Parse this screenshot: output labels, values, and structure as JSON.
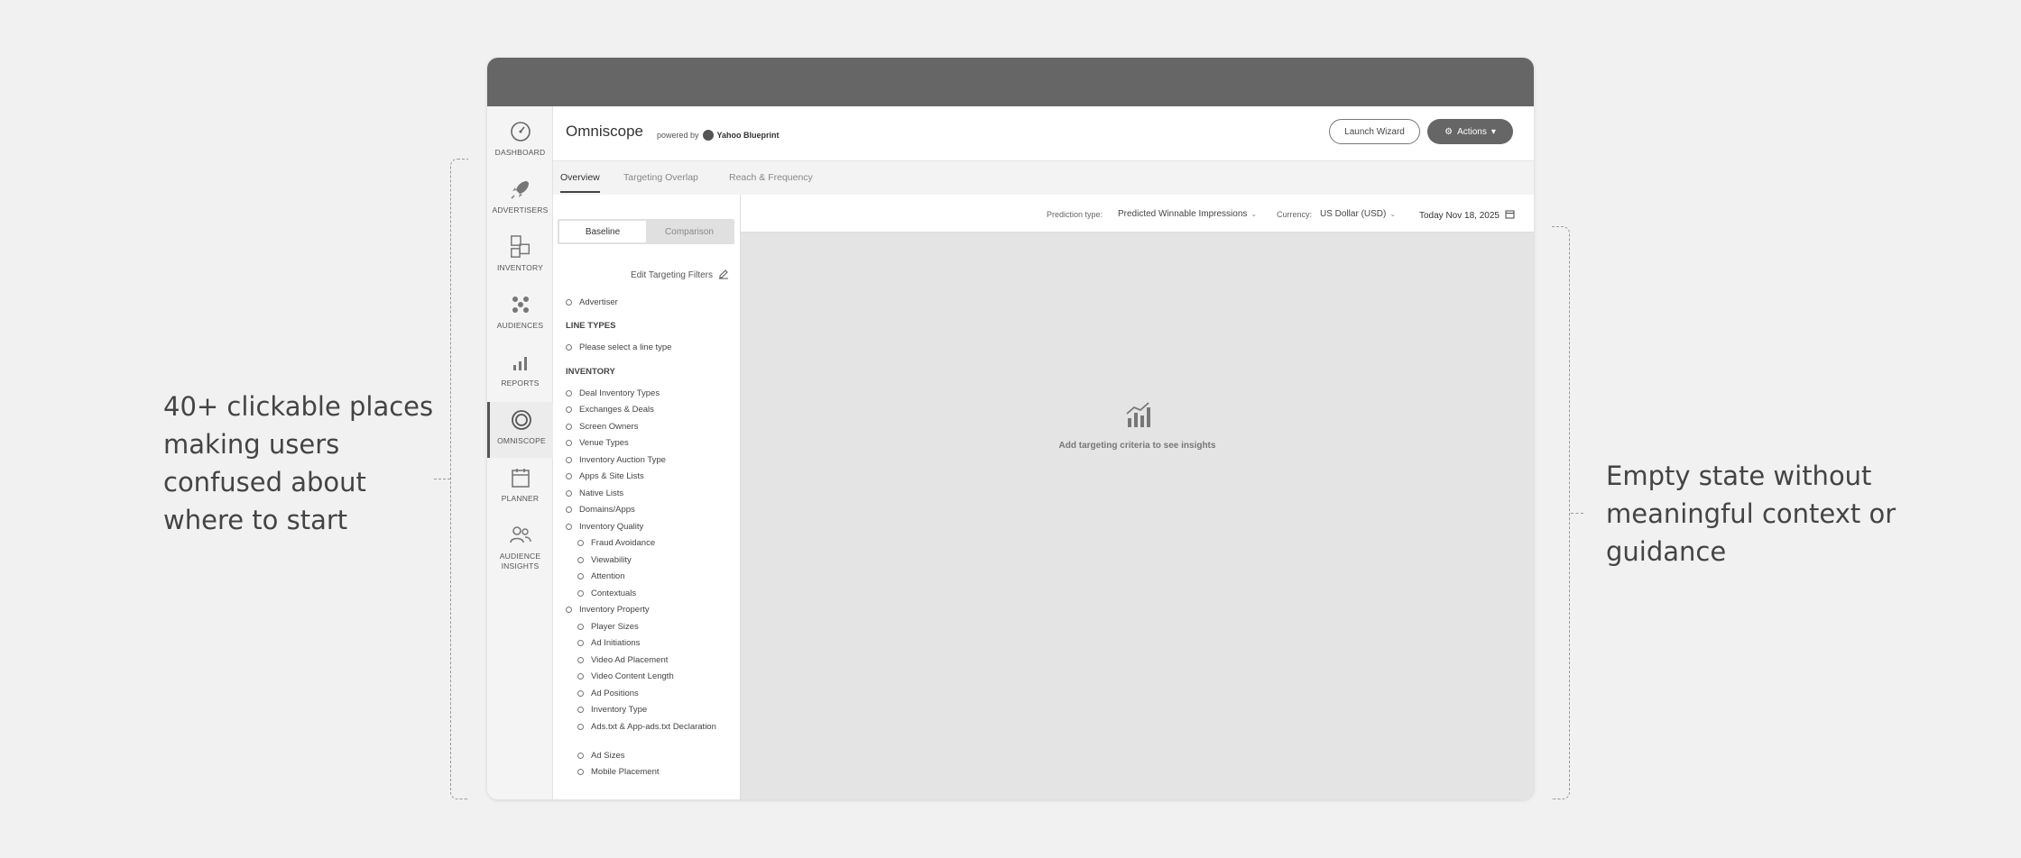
{
  "annotations": {
    "left": "40+ clickable places making users confused about where to start",
    "right": "Empty state without meaningful context or guidance"
  },
  "nav": {
    "items": [
      {
        "label": "DASHBOARD",
        "icon": "dashboard-gauge-icon"
      },
      {
        "label": "ADVERTISERS",
        "icon": "rocket-icon"
      },
      {
        "label": "INVENTORY",
        "icon": "cubes-icon"
      },
      {
        "label": "AUDIENCES",
        "icon": "audience-network-icon"
      },
      {
        "label": "REPORTS",
        "icon": "bar-chart-icon"
      },
      {
        "label": "OMNISCOPE",
        "icon": "omniscope-target-icon",
        "active": true
      },
      {
        "label": "PLANNER",
        "icon": "calendar-icon"
      },
      {
        "label": "AUDIENCE INSIGHTS",
        "icon": "users-icon"
      }
    ]
  },
  "header": {
    "title": "Omniscope",
    "powered_by": "powered by",
    "brand": "Yahoo Blueprint",
    "launch_wizard": "Launch Wizard",
    "actions": "Actions"
  },
  "tabs": [
    "Overview",
    "Targeting Overlap",
    "Reach & Frequency"
  ],
  "filters": {
    "baseline": "Baseline",
    "comparison": "Comparison",
    "edit": "Edit Targeting Filters",
    "advertiser": "Advertiser",
    "line_types_title": "LINE TYPES",
    "line_type_item": "Please select a line type",
    "inventory_title": "INVENTORY",
    "inventory_items": [
      "Deal Inventory Types",
      "Exchanges & Deals",
      "Screen Owners",
      "Venue Types",
      "Inventory Auction Type",
      "Apps & Site Lists",
      "Native Lists",
      "Domains/Apps",
      "Inventory Quality"
    ],
    "quality_items": [
      "Fraud Avoidance",
      "Viewability",
      "Attention",
      "Contextuals"
    ],
    "property": "Inventory Property",
    "property_items": [
      "Player Sizes",
      "Ad Initiations",
      "Video Ad Placement",
      "Video Content Length",
      "Ad Positions",
      "Inventory Type",
      "Ads.txt & App-ads.txt Declaration"
    ],
    "extra_items": [
      "Ad Sizes",
      "Mobile Placement"
    ]
  },
  "toolbar": {
    "prediction_label": "Prediction type:",
    "prediction_value": "Predicted Winnable Impressions",
    "currency_label": "Currency:",
    "currency_value": "US Dollar (USD)",
    "date": "Today Nov 18, 2025"
  },
  "empty_state": {
    "message": "Add targeting criteria to see insights",
    "icon": "bar-chart-trend-icon"
  }
}
